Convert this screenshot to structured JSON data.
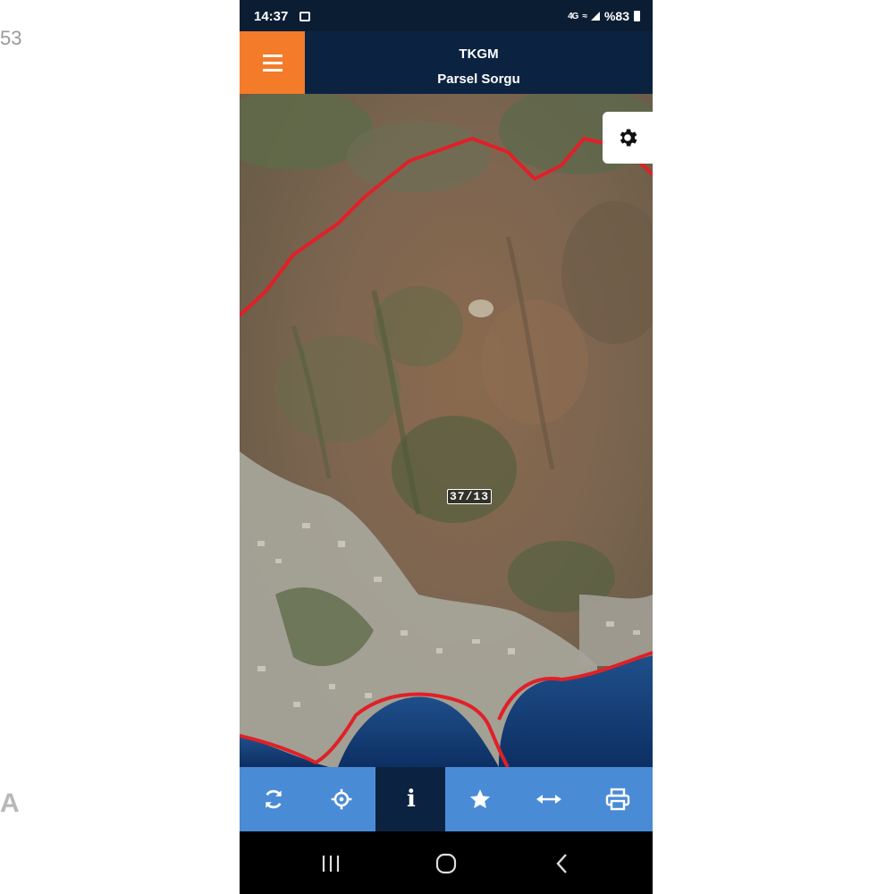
{
  "background": {
    "left_number": "53",
    "left_letter": "A"
  },
  "status_bar": {
    "time": "14:37",
    "battery_percent": "%83",
    "icons": [
      "photo-icon",
      "network-signal-icon",
      "wifi-call-icon",
      "cell-signal-icon",
      "battery-icon"
    ]
  },
  "header": {
    "title": "TKGM",
    "subtitle": "Parsel Sorgu",
    "menu_icon": "hamburger-menu-icon",
    "accent_color": "#f47b2a",
    "bar_color": "#0b2340"
  },
  "map": {
    "view": "satellite",
    "parcel_label": "37/13",
    "boundary_color": "#e02028",
    "settings_icon": "gear-icon"
  },
  "toolbar": {
    "buttons": [
      {
        "name": "refresh",
        "icon": "refresh-icon"
      },
      {
        "name": "locate",
        "icon": "crosshair-icon"
      },
      {
        "name": "info",
        "icon": "info-icon",
        "label": "i",
        "active": true
      },
      {
        "name": "favorite",
        "icon": "star-icon"
      },
      {
        "name": "measure",
        "icon": "arrows-horizontal-icon"
      },
      {
        "name": "print",
        "icon": "printer-icon"
      }
    ],
    "button_color": "#4a8bd6"
  },
  "nav_bar": {
    "buttons": [
      "recent-apps-icon",
      "home-icon",
      "back-icon"
    ]
  }
}
